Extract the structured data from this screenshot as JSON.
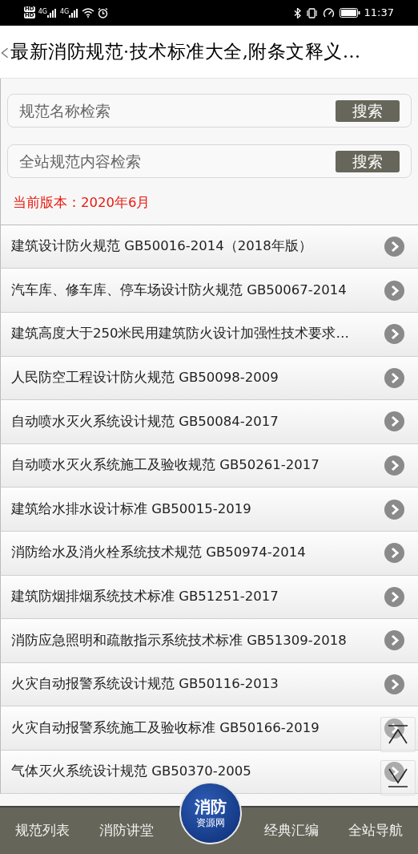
{
  "status_bar": {
    "sim_badges": [
      "HD",
      "HD"
    ],
    "network_labels": [
      "4G",
      "4G"
    ],
    "time": "11:37"
  },
  "header": {
    "title": "最新消防规范·技术标准大全,附条文释义…"
  },
  "searches": [
    {
      "placeholder": "规范名称检索",
      "button": "搜索"
    },
    {
      "placeholder": "全站规范内容检索",
      "button": "搜索"
    }
  ],
  "version": "当前版本：2020年6月",
  "list": [
    {
      "title": "建筑设计防火规范 GB50016-2014（2018年版）"
    },
    {
      "title": "汽车库、修车库、停车场设计防火规范 GB50067-2014"
    },
    {
      "title": "建筑高度大于250米民用建筑防火设计加强性技术要求…"
    },
    {
      "title": "人民防空工程设计防火规范 GB50098-2009"
    },
    {
      "title": "自动喷水灭火系统设计规范 GB50084-2017"
    },
    {
      "title": "自动喷水灭火系统施工及验收规范 GB50261-2017"
    },
    {
      "title": "建筑给水排水设计标准 GB50015-2019"
    },
    {
      "title": "消防给水及消火栓系统技术规范 GB50974-2014"
    },
    {
      "title": "建筑防烟排烟系统技术标准 GB51251-2017"
    },
    {
      "title": "消防应急照明和疏散指示系统技术标准 GB51309-2018"
    },
    {
      "title": "火灾自动报警系统设计规范 GB50116-2013"
    },
    {
      "title": "火灾自动报警系统施工及验收标准 GB50166-2019"
    },
    {
      "title": "气体灭火系统设计规范 GB50370-2005"
    }
  ],
  "bottom_nav": {
    "items": [
      "规范列表",
      "消防讲堂",
      "经典汇编",
      "全站导航"
    ],
    "logo": [
      "消防",
      "资源网"
    ]
  }
}
